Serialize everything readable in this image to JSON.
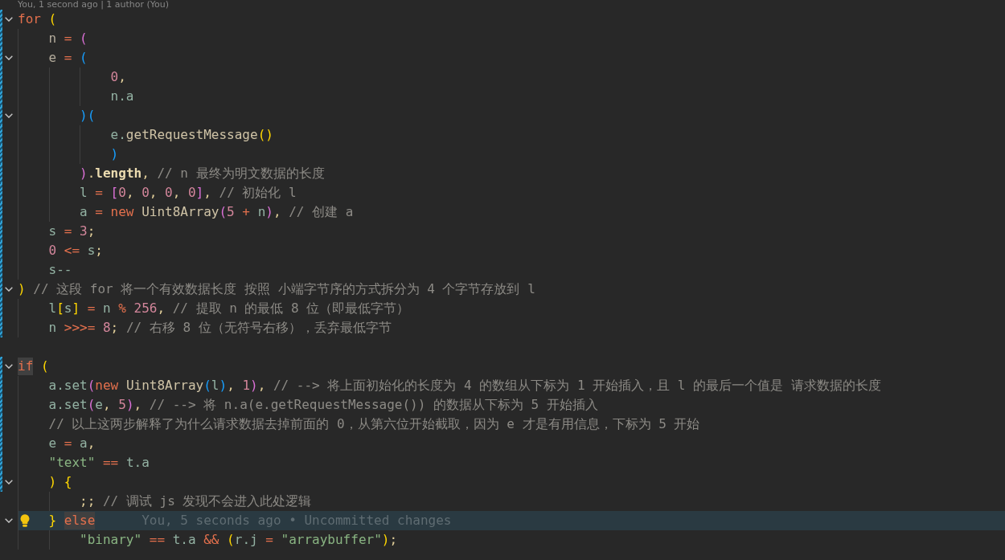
{
  "codelens": "You, 1 second ago | 1 author (You)",
  "lines": [
    {
      "expanded": true,
      "changed": true,
      "current": false,
      "tokens": [
        {
          "kind": "keyword",
          "text": "for "
        },
        {
          "kind": "bracket1",
          "text": "("
        }
      ],
      "children": [
        {
          "changed": true,
          "current": false,
          "tokens": [
            {
              "kind": "variable",
              "text": "n "
            },
            {
              "kind": "operator",
              "text": "= "
            },
            {
              "kind": "bracket2",
              "text": "("
            }
          ]
        },
        {
          "expanded": true,
          "changed": true,
          "current": false,
          "tokens": [
            {
              "kind": "variable",
              "text": "e "
            },
            {
              "kind": "operator",
              "text": "= "
            },
            {
              "kind": "bracket3",
              "text": "("
            }
          ],
          "children": [
            {
              "children": [
                {
                  "changed": true,
                  "current": false,
                  "tokens": [
                    {
                      "kind": "number",
                      "text": "0"
                    },
                    {
                      "kind": "punctuation",
                      "text": ","
                    }
                  ]
                },
                {
                  "changed": true,
                  "current": false,
                  "tokens": [
                    {
                      "kind": "identifier",
                      "text": "n.a"
                    }
                  ]
                }
              ]
            },
            {
              "expanded": true,
              "changed": true,
              "current": false,
              "tokens": [
                {
                  "kind": "bracket3",
                  "text": ")("
                }
              ],
              "children": [
                {
                  "changed": true,
                  "current": false,
                  "tokens": [
                    {
                      "kind": "identifier",
                      "text": "e."
                    },
                    {
                      "kind": "function",
                      "text": "getRequestMessage"
                    },
                    {
                      "kind": "bracket1",
                      "text": "()"
                    }
                  ]
                },
                {
                  "changed": true,
                  "current": false,
                  "tokens": [
                    {
                      "kind": "bracket3",
                      "text": ")"
                    }
                  ]
                }
              ]
            },
            {
              "changed": true,
              "current": false,
              "tokens": [
                {
                  "kind": "bracket2",
                  "text": ")"
                },
                {
                  "kind": "punctuation",
                  "text": "."
                },
                {
                  "kind": "property",
                  "text": "length"
                },
                {
                  "kind": "punctuation",
                  "text": ", "
                },
                {
                  "kind": "comment",
                  "text": "// n 最终为明文数据的长度"
                }
              ]
            },
            {
              "changed": true,
              "current": false,
              "tokens": [
                {
                  "kind": "identifier",
                  "text": "l "
                },
                {
                  "kind": "operator",
                  "text": "= "
                },
                {
                  "kind": "bracket2",
                  "text": "["
                },
                {
                  "kind": "number",
                  "text": "0"
                },
                {
                  "kind": "punctuation",
                  "text": ", "
                },
                {
                  "kind": "number",
                  "text": "0"
                },
                {
                  "kind": "punctuation",
                  "text": ", "
                },
                {
                  "kind": "number",
                  "text": "0"
                },
                {
                  "kind": "punctuation",
                  "text": ", "
                },
                {
                  "kind": "number",
                  "text": "0"
                },
                {
                  "kind": "bracket2",
                  "text": "]"
                },
                {
                  "kind": "punctuation",
                  "text": ", "
                },
                {
                  "kind": "comment",
                  "text": "// 初始化 l"
                }
              ]
            },
            {
              "changed": true,
              "current": false,
              "tokens": [
                {
                  "kind": "identifier",
                  "text": "a "
                },
                {
                  "kind": "operator",
                  "text": "= "
                },
                {
                  "kind": "keyword",
                  "text": "new "
                },
                {
                  "kind": "function",
                  "text": "Uint8Array"
                },
                {
                  "kind": "bracket2",
                  "text": "("
                },
                {
                  "kind": "number",
                  "text": "5 "
                },
                {
                  "kind": "operator",
                  "text": "+ "
                },
                {
                  "kind": "identifier",
                  "text": "n"
                },
                {
                  "kind": "bracket2",
                  "text": ")"
                },
                {
                  "kind": "punctuation",
                  "text": ", "
                },
                {
                  "kind": "comment",
                  "text": "// 创建 a"
                }
              ]
            }
          ]
        },
        {
          "changed": true,
          "current": false,
          "tokens": [
            {
              "kind": "identifier",
              "text": "s "
            },
            {
              "kind": "operator",
              "text": "= "
            },
            {
              "kind": "number",
              "text": "3"
            },
            {
              "kind": "punctuation",
              "text": ";"
            }
          ]
        },
        {
          "changed": true,
          "current": false,
          "tokens": [
            {
              "kind": "number",
              "text": "0 "
            },
            {
              "kind": "operator",
              "text": "<= "
            },
            {
              "kind": "identifier",
              "text": "s"
            },
            {
              "kind": "punctuation",
              "text": ";"
            }
          ]
        },
        {
          "changed": true,
          "current": false,
          "tokens": [
            {
              "kind": "identifier",
              "text": "s--"
            }
          ]
        }
      ]
    },
    {
      "expanded": true,
      "changed": true,
      "current": false,
      "tokens": [
        {
          "kind": "bracket1",
          "text": ") "
        },
        {
          "kind": "comment",
          "text": "// 这段 for 将一个有效数据长度 按照 小端字节序的方式拆分为 4 个字节存放到 l"
        }
      ],
      "children": [
        {
          "changed": true,
          "current": false,
          "tokens": [
            {
              "kind": "identifier",
              "text": "l"
            },
            {
              "kind": "bracket1",
              "text": "["
            },
            {
              "kind": "identifier",
              "text": "s"
            },
            {
              "kind": "bracket1",
              "text": "] "
            },
            {
              "kind": "operator",
              "text": "= "
            },
            {
              "kind": "identifier",
              "text": "n "
            },
            {
              "kind": "operator",
              "text": "% "
            },
            {
              "kind": "number",
              "text": "256"
            },
            {
              "kind": "punctuation",
              "text": ", "
            },
            {
              "kind": "comment",
              "text": "// 提取 n 的最低 8 位（即最低字节）"
            }
          ]
        },
        {
          "changed": true,
          "current": false,
          "tokens": [
            {
              "kind": "identifier",
              "text": "n "
            },
            {
              "kind": "operator",
              "text": ">>>= "
            },
            {
              "kind": "number",
              "text": "8"
            },
            {
              "kind": "punctuation",
              "text": "; "
            },
            {
              "kind": "comment",
              "text": "// 右移 8 位（无符号右移），丢弃最低字节"
            }
          ]
        }
      ]
    },
    {
      "changed": false,
      "current": false
    },
    {
      "expanded": true,
      "changed": true,
      "current": false,
      "tokens": [
        {
          "kind": "keyword",
          "text": "if",
          "highlighted": true
        },
        {
          "kind": "bracket1",
          "text": " ("
        }
      ],
      "children": [
        {
          "changed": true,
          "current": false,
          "tokens": [
            {
              "kind": "identifier",
              "text": "a.set"
            },
            {
              "kind": "bracket2",
              "text": "("
            },
            {
              "kind": "keyword",
              "text": "new "
            },
            {
              "kind": "function",
              "text": "Uint8Array"
            },
            {
              "kind": "bracket3",
              "text": "("
            },
            {
              "kind": "identifier",
              "text": "l"
            },
            {
              "kind": "bracket3",
              "text": ")"
            },
            {
              "kind": "punctuation",
              "text": ", "
            },
            {
              "kind": "number",
              "text": "1"
            },
            {
              "kind": "bracket2",
              "text": ")"
            },
            {
              "kind": "punctuation",
              "text": ", "
            },
            {
              "kind": "comment",
              "text": "// --> 将上面初始化的长度为 4 的数组从下标为 1 开始插入，且 l 的最后一个值是 请求数据的长度"
            }
          ]
        },
        {
          "changed": true,
          "current": false,
          "tokens": [
            {
              "kind": "identifier",
              "text": "a.set"
            },
            {
              "kind": "bracket2",
              "text": "("
            },
            {
              "kind": "identifier",
              "text": "e"
            },
            {
              "kind": "punctuation",
              "text": ", "
            },
            {
              "kind": "number",
              "text": "5"
            },
            {
              "kind": "bracket2",
              "text": ")"
            },
            {
              "kind": "punctuation",
              "text": ", "
            },
            {
              "kind": "comment",
              "text": "// --> 将 n.a(e.getRequestMessage()) 的数据从下标为 5 开始插入"
            }
          ]
        },
        {
          "changed": true,
          "current": false,
          "tokens": [
            {
              "kind": "comment",
              "text": "// 以上这两步解释了为什么请求数据去掉前面的 0，从第六位开始截取，因为 e 才是有用信息，下标为 5 开始"
            }
          ]
        },
        {
          "changed": true,
          "current": false,
          "tokens": [
            {
              "kind": "identifier",
              "text": "e "
            },
            {
              "kind": "operator",
              "text": "= "
            },
            {
              "kind": "identifier",
              "text": "a"
            },
            {
              "kind": "punctuation",
              "text": ","
            }
          ]
        },
        {
          "changed": true,
          "current": false,
          "tokens": [
            {
              "kind": "string",
              "text": "\"text\" "
            },
            {
              "kind": "operator",
              "text": "== "
            },
            {
              "kind": "identifier",
              "text": "t.a"
            }
          ]
        },
        {
          "expanded": true,
          "changed": true,
          "current": false,
          "tokens": [
            {
              "kind": "bracket1",
              "text": ") {"
            }
          ],
          "children": [
            {
              "changed": false,
              "current": false,
              "tokens": [
                {
                  "kind": "punctuation",
                  "text": ";; "
                },
                {
                  "kind": "comment",
                  "text": "// 调试 js 发现不会进入此处逻辑"
                }
              ]
            }
          ]
        },
        {
          "expanded": true,
          "changed": false,
          "current": true,
          "lightbulb": true,
          "blame": "You, 5 seconds ago • Uncommitted changes",
          "tokens": [
            {
              "kind": "bracket1",
              "text": "} "
            },
            {
              "kind": "keyword",
              "text": "else",
              "highlighted": true
            }
          ],
          "children": [
            {
              "changed": false,
              "current": false,
              "tokens": [
                {
                  "kind": "string",
                  "text": "\"binary\" "
                },
                {
                  "kind": "operator",
                  "text": "== "
                },
                {
                  "kind": "identifier",
                  "text": "t.a "
                },
                {
                  "kind": "operator",
                  "text": "&& "
                },
                {
                  "kind": "bracket1",
                  "text": "("
                },
                {
                  "kind": "identifier",
                  "text": "r.j "
                },
                {
                  "kind": "operator",
                  "text": "= "
                },
                {
                  "kind": "string",
                  "text": "\"arraybuffer\""
                },
                {
                  "kind": "bracket1",
                  "text": ")"
                },
                {
                  "kind": "punctuation",
                  "text": ";"
                }
              ]
            }
          ]
        }
      ]
    }
  ]
}
